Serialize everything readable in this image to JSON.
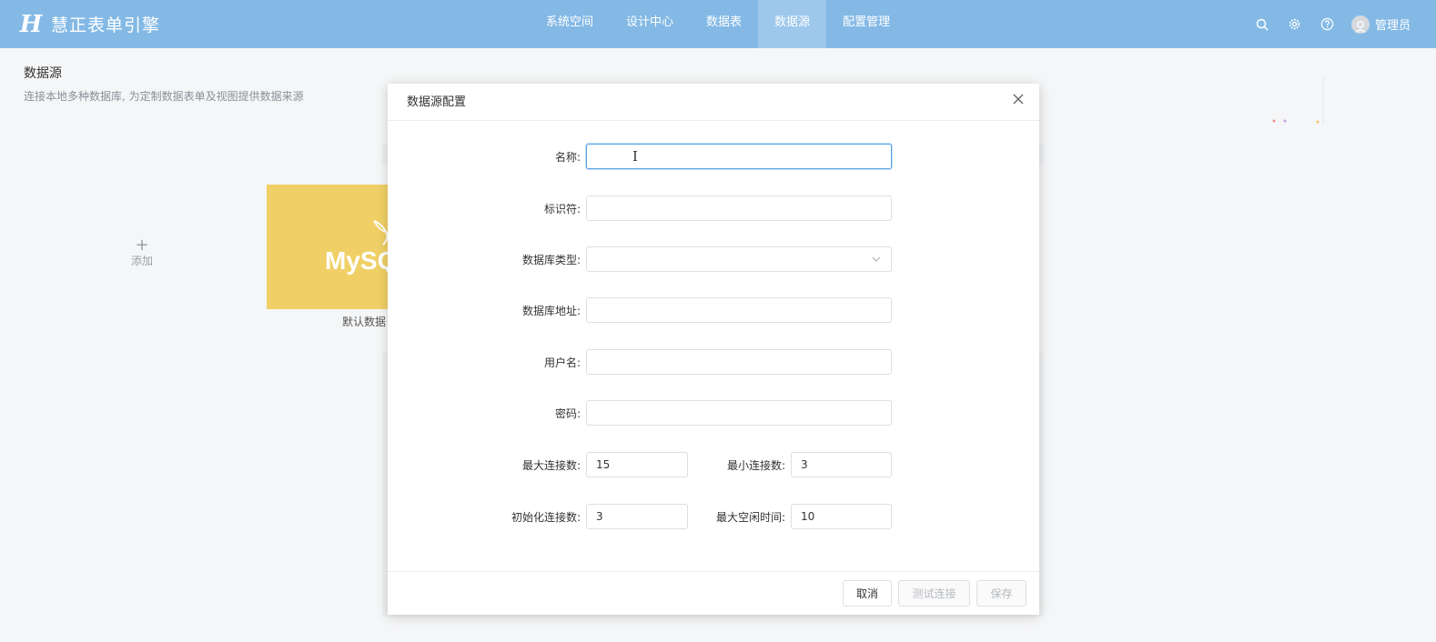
{
  "header": {
    "logo_icon": "H-logo-icon",
    "app_title": "慧正表单引擎",
    "nav": [
      {
        "label": "系统空间",
        "active": false
      },
      {
        "label": "设计中心",
        "active": false
      },
      {
        "label": "数据表",
        "active": false
      },
      {
        "label": "数据源",
        "active": true
      },
      {
        "label": "配置管理",
        "active": false
      }
    ],
    "user_name": "管理员"
  },
  "page": {
    "title": "数据源",
    "description": "连接本地多种数据库, 为定制数据表单及视图提供数据来源",
    "add_label": "添加",
    "add_icon": "+",
    "card_logo_text": "MySQ",
    "card_label": "默认数据"
  },
  "modal": {
    "title": "数据源配置",
    "fields": {
      "name": {
        "label": "名称:",
        "value": ""
      },
      "identifier": {
        "label": "标识符:",
        "value": ""
      },
      "db_type": {
        "label": "数据库类型:",
        "value": ""
      },
      "db_address": {
        "label": "数据库地址:",
        "value": ""
      },
      "username": {
        "label": "用户名:",
        "value": ""
      },
      "password": {
        "label": "密码:",
        "value": ""
      },
      "max_conn": {
        "label": "最大连接数:",
        "value": "15"
      },
      "min_conn": {
        "label": "最小连接数:",
        "value": "3"
      },
      "init_conn": {
        "label": "初始化连接数:",
        "value": "3"
      },
      "max_idle": {
        "label": "最大空闲时间:",
        "value": "10"
      }
    },
    "buttons": {
      "cancel": "取消",
      "test": "测试连接",
      "save": "保存"
    }
  },
  "colors": {
    "header_bg": "#84b9e5",
    "active_nav": "#9dc7eb",
    "focus_border": "#5aa1e3",
    "card_bg": "#f0d066"
  }
}
